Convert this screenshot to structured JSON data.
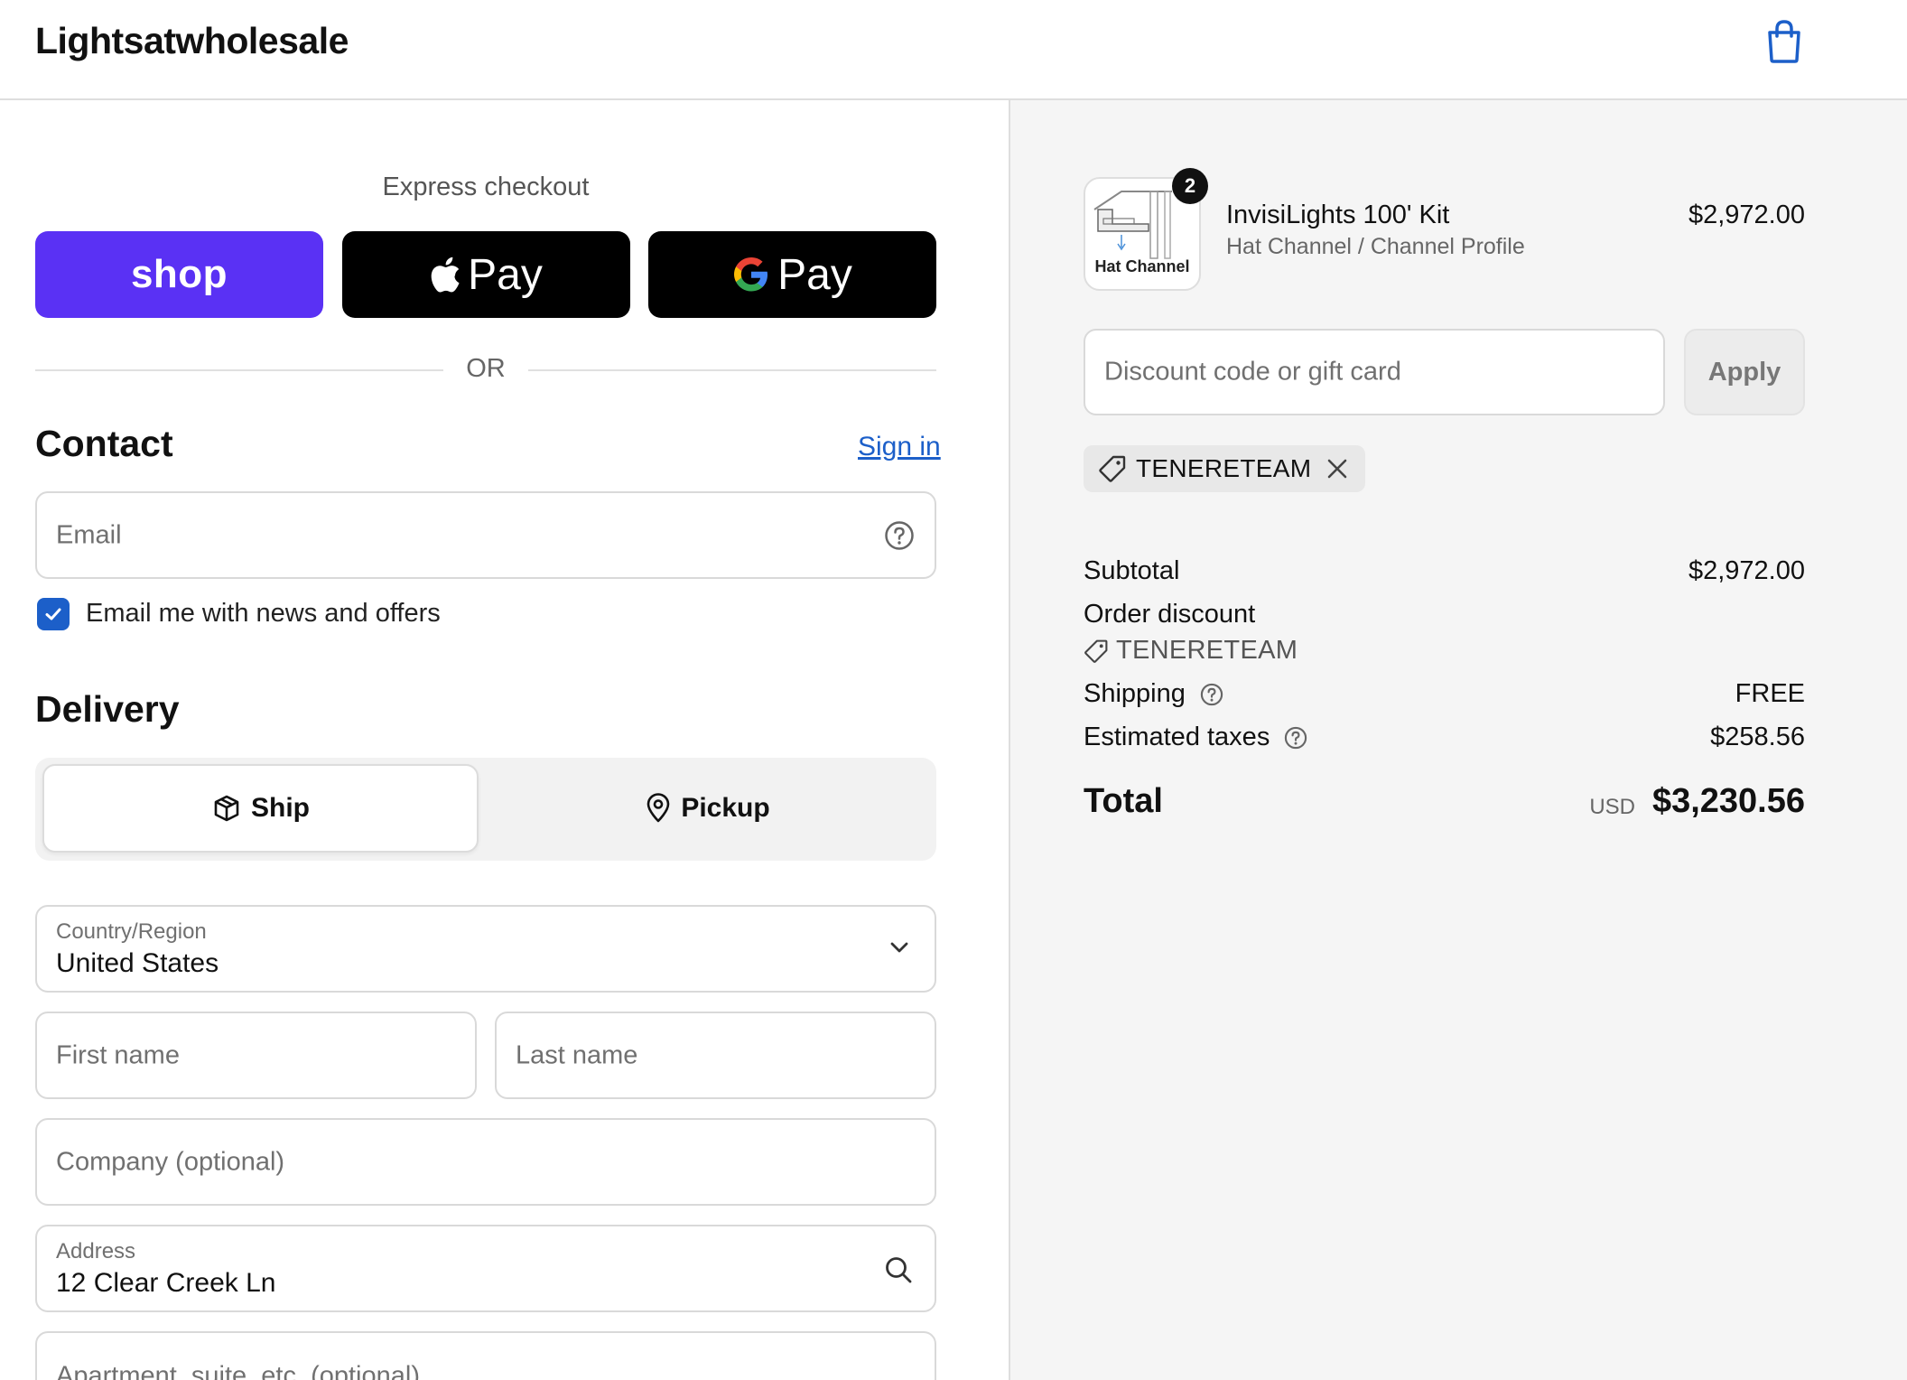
{
  "header": {
    "store_name": "Lightsatwholesale",
    "cart_icon": "shopping-bag-icon"
  },
  "express": {
    "title": "Express checkout",
    "shop_label": "shop",
    "apple_pay_label": "Pay",
    "google_pay_label": "Pay",
    "divider_text": "OR"
  },
  "contact": {
    "title": "Contact",
    "sign_in": "Sign in",
    "email_placeholder": "Email",
    "marketing_label": "Email me with news and offers",
    "marketing_checked": true
  },
  "delivery": {
    "title": "Delivery",
    "ship_label": "Ship",
    "pickup_label": "Pickup",
    "selected": "Ship",
    "country_label": "Country/Region",
    "country_value": "United States",
    "first_name_placeholder": "First name",
    "last_name_placeholder": "Last name",
    "company_placeholder": "Company (optional)",
    "address_label": "Address",
    "address_value": "12 Clear Creek Ln",
    "apartment_placeholder": "Apartment, suite, etc. (optional)"
  },
  "summary": {
    "product": {
      "name": "InvisiLights 100' Kit",
      "variant": "Hat Channel / Channel Profile",
      "price": "$2,972.00",
      "quantity": "2",
      "thumb_label": "Hat Channel"
    },
    "discount_placeholder": "Discount code or gift card",
    "apply_label": "Apply",
    "applied_code": "TENERETEAM",
    "subtotal_label": "Subtotal",
    "subtotal_value": "$2,972.00",
    "order_discount_label": "Order discount",
    "order_discount_code": "TENERETEAM",
    "shipping_label": "Shipping",
    "shipping_value": "FREE",
    "taxes_label": "Estimated taxes",
    "taxes_value": "$258.56",
    "total_label": "Total",
    "total_currency": "USD",
    "total_value": "$3,230.56"
  },
  "colors": {
    "shop_purple": "#5a31f4",
    "link_blue": "#1c5fc9",
    "summary_bg": "#f5f5f5"
  }
}
